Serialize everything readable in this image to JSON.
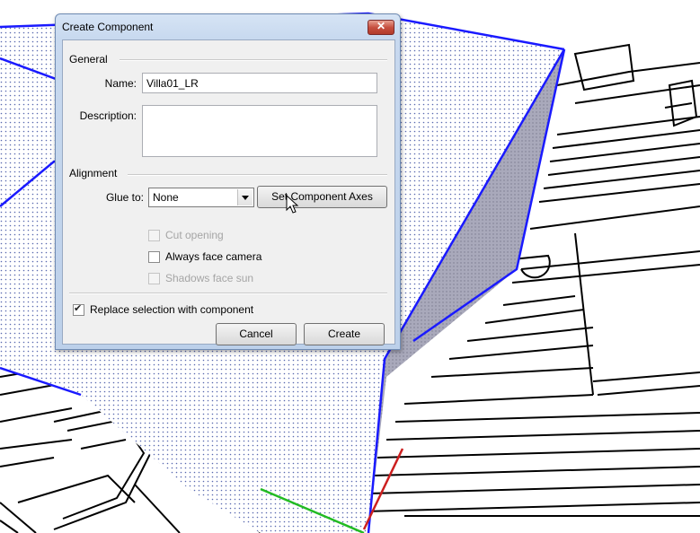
{
  "dialog": {
    "title": "Create Component",
    "close_icon": "close-icon",
    "general": {
      "heading": "General",
      "name_label": "Name:",
      "name_value": "Villa01_LR",
      "description_label": "Description:",
      "description_value": ""
    },
    "alignment": {
      "heading": "Alignment",
      "glue_label": "Glue to:",
      "glue_value": "None",
      "set_axes_label": "Set Component Axes",
      "cut_opening": {
        "label": "Cut opening",
        "checked": false,
        "enabled": false
      },
      "always_face_camera": {
        "label": "Always face camera",
        "checked": false,
        "enabled": true
      },
      "shadows_face_sun": {
        "label": "Shadows face sun",
        "checked": false,
        "enabled": false
      }
    },
    "replace_selection": {
      "label": "Replace selection with component",
      "checked": true
    },
    "cancel_label": "Cancel",
    "create_label": "Create"
  },
  "colors": {
    "edge_blue": "#1a1aff",
    "axis_green": "#22bb22",
    "axis_red": "#cc1f1f",
    "face_gray": "#a8a8b8"
  }
}
